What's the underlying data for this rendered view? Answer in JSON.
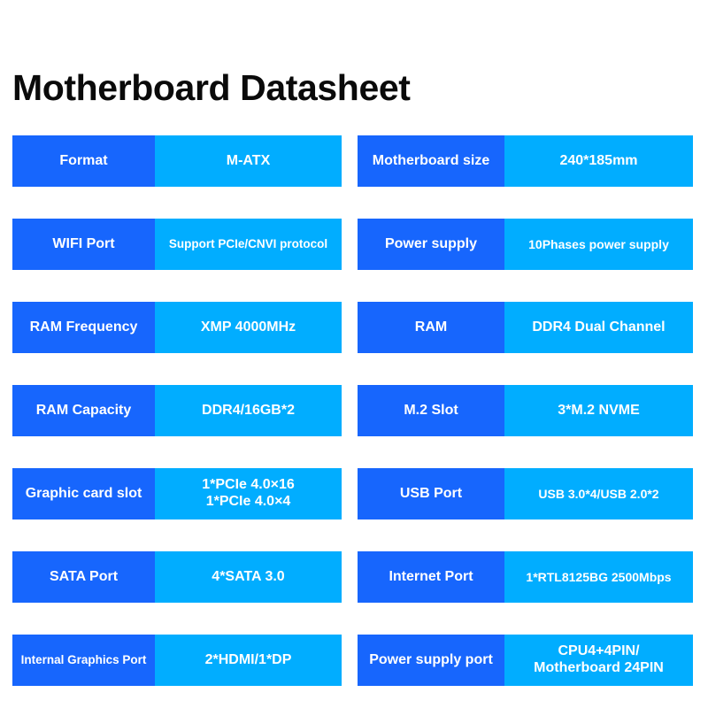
{
  "title": "Motherboard Datasheet",
  "colors": {
    "label_bg": "#1766fd",
    "value_bg": "#01adff",
    "text": "#ffffff",
    "title_text": "#0a0a0a",
    "page_bg": "#ffffff"
  },
  "specs": {
    "left_column": [
      {
        "label": "Format",
        "value": [
          "M-ATX"
        ]
      },
      {
        "label": "WIFI Port",
        "value": [
          "Support PCIe/CNVI protocol"
        ]
      },
      {
        "label": "RAM Frequency",
        "value": [
          "XMP 4000MHz"
        ]
      },
      {
        "label": "RAM Capacity",
        "value": [
          "DDR4/16GB*2"
        ]
      },
      {
        "label": "Graphic card slot",
        "value": [
          "1*PCIe 4.0×16",
          "1*PCIe 4.0×4"
        ]
      },
      {
        "label": "SATA Port",
        "value": [
          "4*SATA 3.0"
        ]
      },
      {
        "label": "Internal Graphics Port",
        "value": [
          "2*HDMI/1*DP"
        ]
      }
    ],
    "right_column": [
      {
        "label": "Motherboard size",
        "value": [
          "240*185mm"
        ]
      },
      {
        "label": "Power supply",
        "value": [
          "10Phases power supply"
        ]
      },
      {
        "label": "RAM",
        "value": [
          "DDR4 Dual Channel"
        ]
      },
      {
        "label": "M.2 Slot",
        "value": [
          "3*M.2 NVME"
        ]
      },
      {
        "label": "USB Port",
        "value": [
          "USB 3.0*4/USB 2.0*2"
        ]
      },
      {
        "label": "Internet Port",
        "value": [
          "1*RTL8125BG 2500Mbps"
        ]
      },
      {
        "label": "Power supply port",
        "value": [
          "CPU4+4PIN/",
          "Motherboard 24PIN"
        ]
      }
    ]
  }
}
